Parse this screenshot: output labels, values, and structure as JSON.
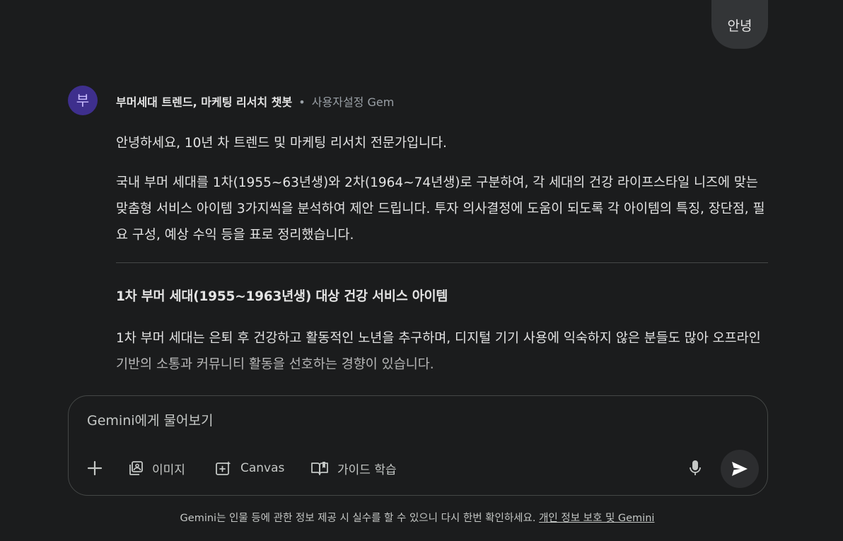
{
  "user_message": {
    "text": "안녕"
  },
  "gem": {
    "avatar_letter": "부",
    "name": "부머세대 트렌드, 마케팅 리서치 챗봇",
    "separator": "•",
    "type": "사용자설정 Gem"
  },
  "response": {
    "intro": "안녕하세요, 10년 차 트렌드 및 마케팅 리서치 전문가입니다.",
    "body": "국내 부머 세대를 1차(1955~63년생)와 2차(1964~74년생)로 구분하여, 각 세대의 건강 라이프스타일 니즈에 맞는 맞춤형 서비스 아이템 3가지씩을 분석하여 제안 드립니다. 투자 의사결정에 도움이 되도록 각 아이템의 특징, 장단점, 필요 구성, 예상 수익 등을 표로 정리했습니다.",
    "section_heading": "1차 부머 세대(1955~1963년생) 대상 건강 서비스 아이템",
    "section_body": "1차 부머 세대는 은퇴 후 건강하고 활동적인 노년을 추구하며, 디지털 기기 사용에 익숙하지 않은 분들도 많아 오프라인 기반의 소통과 커뮤니티 활동을 선호하는 경향이 있습니다."
  },
  "input": {
    "placeholder": "Gemini에게 물어보기",
    "value": ""
  },
  "toolbar": {
    "image_label": "이미지",
    "canvas_label": "Canvas",
    "guide_label": "가이드 학습"
  },
  "icons": {
    "plus": "plus-icon",
    "image": "image-icon",
    "canvas": "canvas-icon",
    "guide": "book-icon",
    "mic": "mic-icon",
    "send": "send-icon"
  },
  "footer": {
    "disclaimer": "Gemini는 인물 등에 관한 정보 제공 시 실수를 할 수 있으니 다시 한번 확인하세요.",
    "link": "개인 정보 보호 및 Gemini"
  }
}
